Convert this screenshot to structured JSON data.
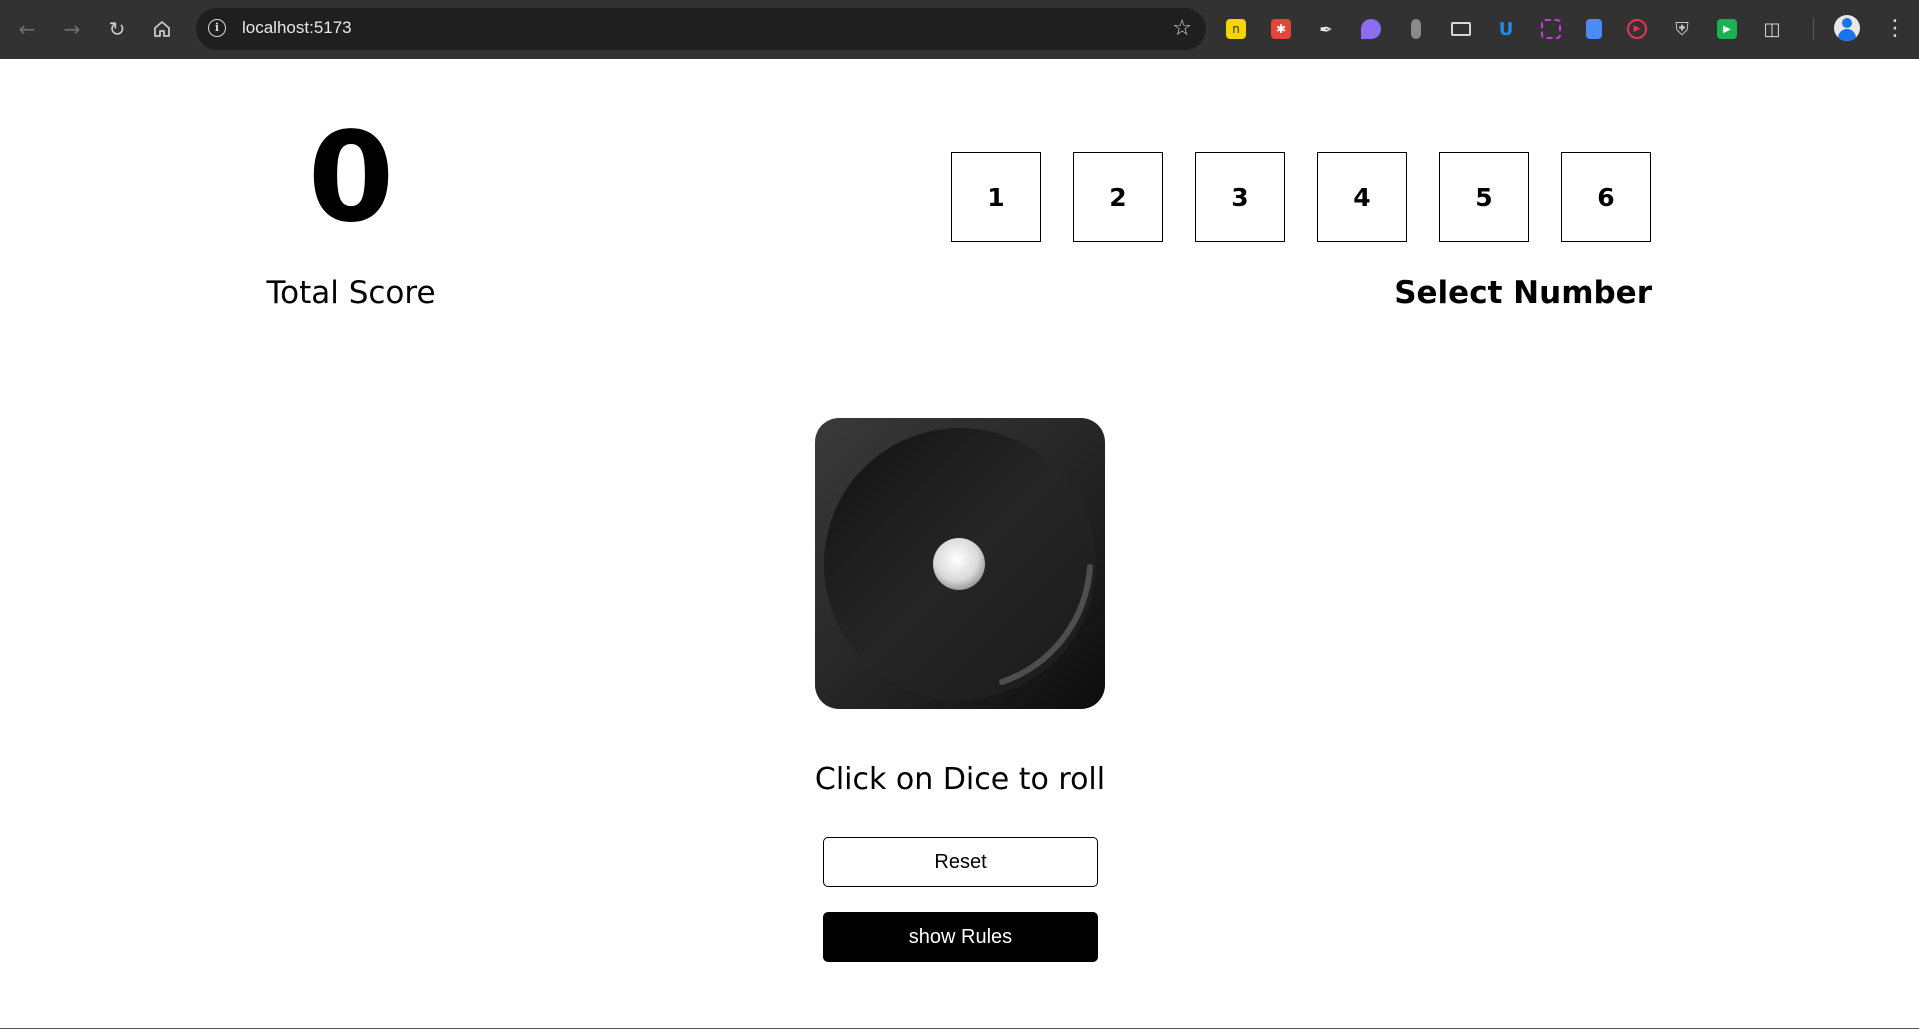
{
  "browser": {
    "url": "localhost:5173",
    "extensions": [
      {
        "icon": "notes-extension-icon",
        "color": "#f5d400"
      },
      {
        "icon": "puzzle-red-extension-icon",
        "color": "#e0463a"
      },
      {
        "icon": "eyedropper-icon",
        "color": "#e8e8e8"
      },
      {
        "icon": "feather-extension-icon",
        "color": "#8c6cf0"
      },
      {
        "icon": "dropper-grey-extension-icon",
        "color": "#8a8a8a"
      },
      {
        "icon": "picture-in-picture-icon",
        "color": "#d7d7d7"
      },
      {
        "icon": "u-extension-icon",
        "color": "#1b8cf0"
      },
      {
        "icon": "screen-capture-icon",
        "color": "#c33bd6"
      },
      {
        "icon": "document-extension-icon",
        "color": "#4a8cf7"
      },
      {
        "icon": "record-extension-icon",
        "color": "#e53355"
      },
      {
        "icon": "shield-extension-icon",
        "color": "#c8c8c8"
      },
      {
        "icon": "play-extension-icon",
        "color": "#19b255"
      },
      {
        "icon": "extensions-puzzle-icon",
        "color": "#d7d7d7"
      }
    ]
  },
  "game": {
    "total_score": "0",
    "total_score_label": "Total Score",
    "select_label": "Select Number",
    "numbers": [
      "1",
      "2",
      "3",
      "4",
      "5",
      "6"
    ],
    "dice_value": 1,
    "roll_hint": "Click on Dice to roll",
    "reset_label": "Reset",
    "rules_label": "show Rules"
  }
}
